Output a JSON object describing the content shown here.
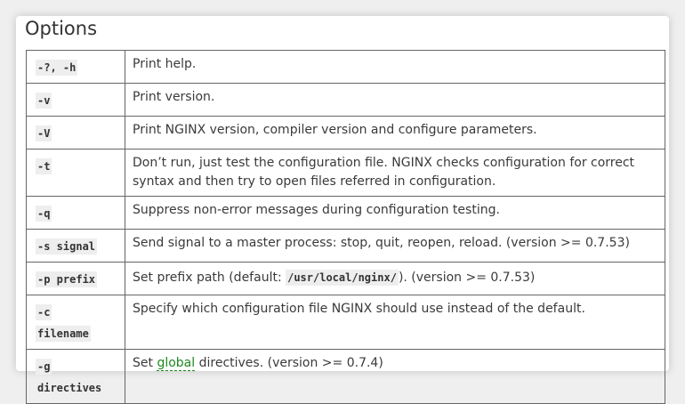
{
  "heading": "Options",
  "options": [
    {
      "flag": "-?, -h",
      "desc": "Print help."
    },
    {
      "flag": "-v",
      "desc": "Print version."
    },
    {
      "flag": "-V",
      "desc": "Print NGINX version, compiler version and configure parameters."
    },
    {
      "flag": "-t",
      "desc": "Don’t run, just test the configuration file. NGINX checks configuration for correct syntax and then try to open files referred in configuration."
    },
    {
      "flag": "-q",
      "desc": "Suppress non-error messages during configuration testing."
    },
    {
      "flag": "-s signal",
      "desc": "Send signal to a master process: stop, quit, reopen, reload. (version >= 0.7.53)"
    },
    {
      "flag": "-p prefix",
      "desc_before": "Set prefix path (default: ",
      "desc_code": "/usr/local/nginx/",
      "desc_after": "). (version >= 0.7.53)"
    },
    {
      "flag_line1": "-c",
      "flag_line2": "filename",
      "desc": "Specify which configuration file NGINX should use instead of the default."
    },
    {
      "flag_line1": "-g",
      "flag_line2": "directives",
      "desc_before": "Set ",
      "desc_link": "global",
      "desc_after": " directives. (version >= 0.7.4)"
    }
  ]
}
